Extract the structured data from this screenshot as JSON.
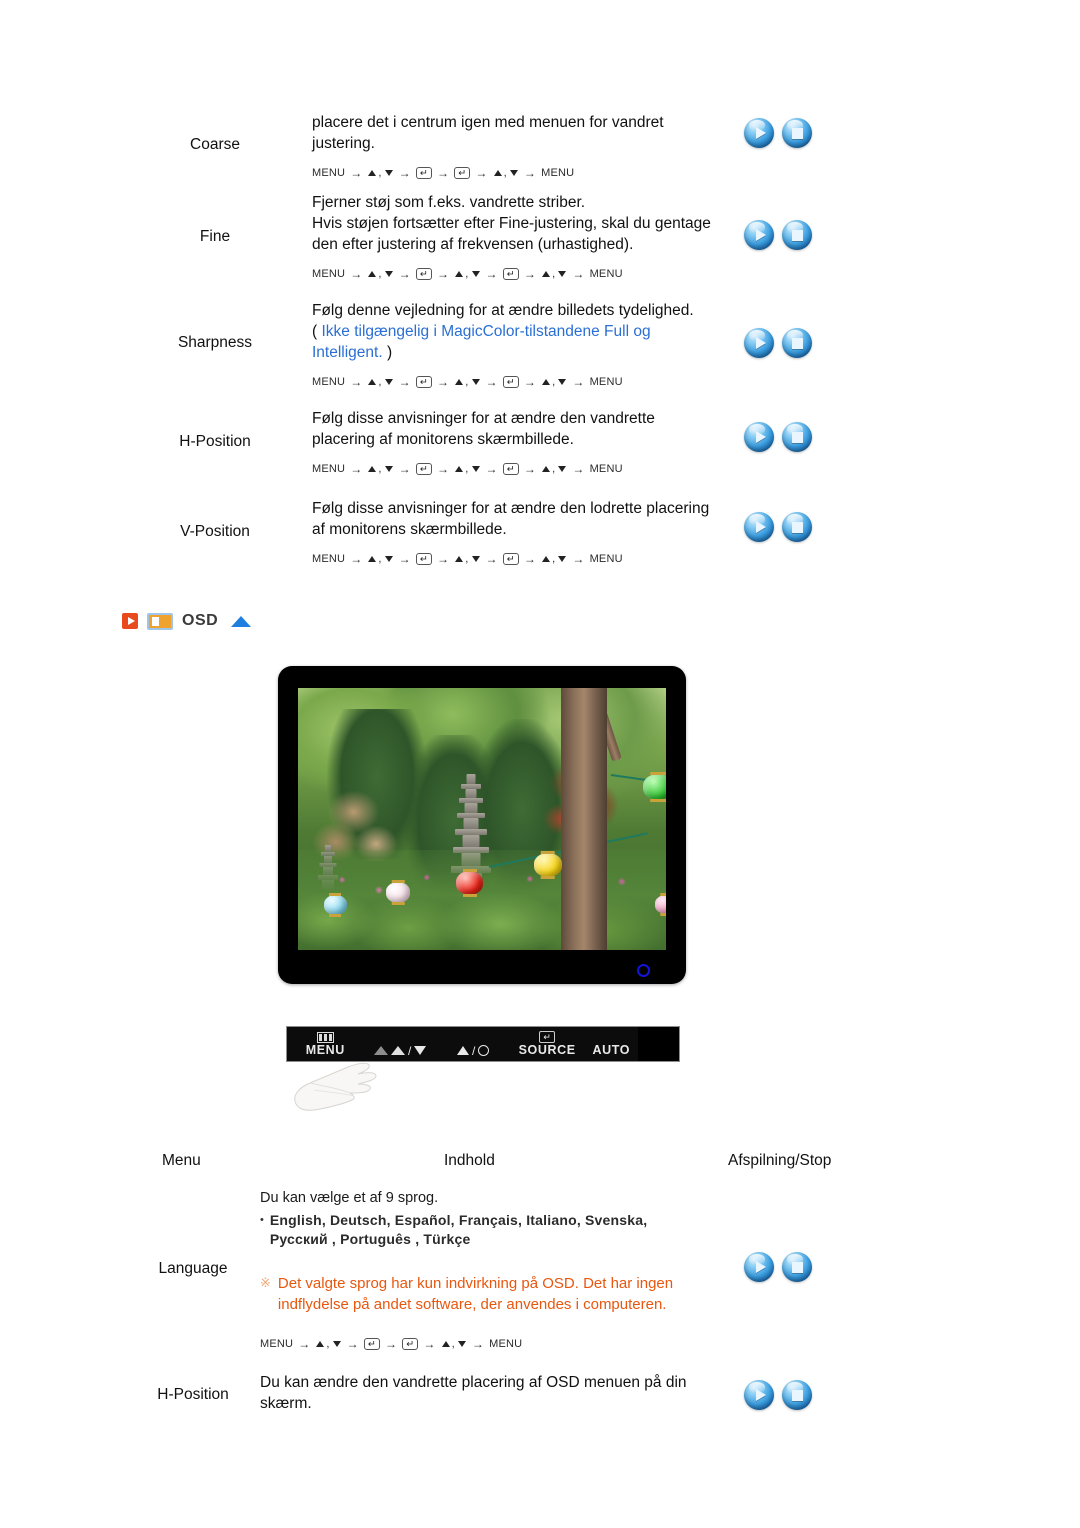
{
  "upper_section": {
    "rows": [
      {
        "label": "Coarse",
        "desc_line1": "placere det i centrum igen med menuen for vandret",
        "desc_line2": "justering.",
        "nav": "short"
      },
      {
        "label": "Fine",
        "desc_line1": "Fjerner støj som f.eks. vandrette striber.",
        "desc_line2": "Hvis støjen fortsætter efter Fine-justering, skal du gentage",
        "desc_line3": "den efter justering af frekvensen (urhastighed).",
        "nav": "long"
      },
      {
        "label": "Sharpness",
        "desc_line1": "Følg denne vejledning for at ændre billedets tydelighed.",
        "note_open": "( ",
        "note_blue_line1": "Ikke tilgængelig i MagicColor-tilstandene Full og",
        "note_blue_line2": "Intelligent.",
        "note_close": " )",
        "nav": "long"
      },
      {
        "label": "H-Position",
        "desc_line1": "Følg disse anvisninger for at ændre den vandrette",
        "desc_line2": "placering af monitorens skærmbillede.",
        "nav": "long"
      },
      {
        "label": "V-Position",
        "desc_line1": "Følg disse anvisninger for at ændre den lodrette placering",
        "desc_line2": "af monitorens skærmbillede.",
        "nav": "long"
      }
    ]
  },
  "nav_tokens": {
    "menu": "MENU",
    "arrow": "→",
    "comma": ",",
    "enter": "↵"
  },
  "osd_section": {
    "title": "OSD",
    "play_icon": "play-icon",
    "monitor_icon": "monitor-icon",
    "collapse_icon": "triangle-up-icon"
  },
  "monitor_illustration": {
    "alt": "monitor-showing-garden-photo",
    "power_led": "power-led-indicator"
  },
  "button_bar": {
    "buttons": [
      {
        "label": "MENU",
        "icon": "menu-bars-icon"
      },
      {
        "label": "",
        "icon": "contrast-down-icon",
        "glyph": "/▼"
      },
      {
        "label": "",
        "icon": "brightness-up-icon",
        "glyph": "▲/☀"
      },
      {
        "label": "SOURCE",
        "icon": "enter-key-icon"
      },
      {
        "label": "AUTO",
        "icon": ""
      }
    ],
    "power_button": "power-button"
  },
  "bottom_table": {
    "headers": {
      "menu": "Menu",
      "content": "Indhold",
      "playstop": "Afspilning/Stop"
    },
    "rows": [
      {
        "label": "Language",
        "line1": "Du kan vælge et af 9 sprog.",
        "bullet_dot": "•",
        "langs_line1": "English, Deutsch, Español, Français,  Italiano, Svenska,",
        "langs_line2": "Русский , Português , Türkçe",
        "warn_mark": "※",
        "warn_line1": "Det valgte sprog har kun indvirkning på OSD. Det har ingen",
        "warn_line2": "indflydelse på andet software, der anvendes i computeren.",
        "nav": "short"
      },
      {
        "label": "H-Position",
        "line1": "Du kan ændre den vandrette placering af OSD menuen på din",
        "line2": "skærm.",
        "nav": "none"
      }
    ]
  },
  "colors": {
    "link_blue": "#2a6fd4",
    "warning_orange": "#e8570f",
    "accent_red": "#e8491d",
    "accent_amber": "#f0a22e",
    "triangle_blue": "#1f7fe0",
    "led_blue": "#1414d8"
  }
}
